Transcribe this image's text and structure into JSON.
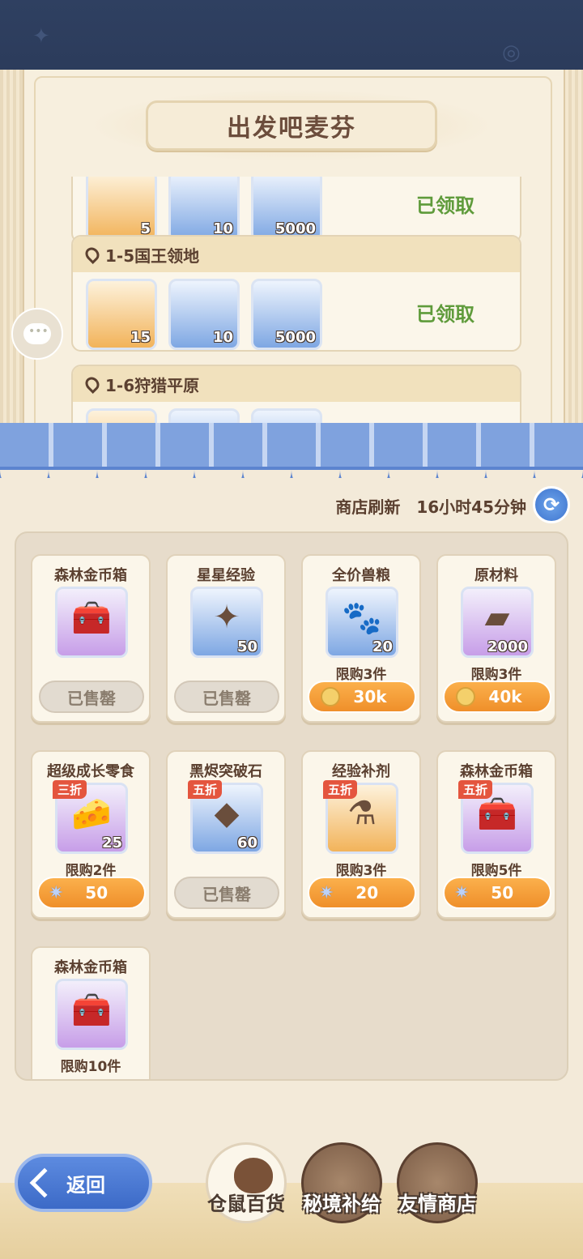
{
  "page_title": "出发吧麦芬",
  "stages": [
    {
      "name": "",
      "rewards": [
        {
          "icon": "blue-card",
          "count": "5",
          "bg": "orange"
        },
        {
          "icon": "dark-stone",
          "count": "10",
          "bg": "blue"
        },
        {
          "icon": "gold-coin",
          "count": "5000",
          "bg": "blue"
        }
      ],
      "status": "已领取"
    },
    {
      "name": "1-5国王领地",
      "rewards": [
        {
          "icon": "star-crystal",
          "count": "15",
          "bg": "orange"
        },
        {
          "icon": "star-card",
          "count": "10",
          "bg": "blue"
        },
        {
          "icon": "gold-coin",
          "count": "5000",
          "bg": "blue"
        }
      ],
      "status": "已领取"
    },
    {
      "name": "1-6狩猎平原",
      "rewards": [],
      "status": ""
    }
  ],
  "shop": {
    "refresh_label": "商店刷新",
    "refresh_time": "16小时45分钟",
    "items": [
      {
        "name": "森林金币箱",
        "icon": "treasure-chest",
        "bg": "purple",
        "count": "",
        "tag": "",
        "limit": "",
        "sold_out": "已售罄",
        "price": ""
      },
      {
        "name": "星星经验",
        "icon": "star-card",
        "bg": "blue",
        "count": "50",
        "tag": "",
        "limit": "",
        "sold_out": "已售罄",
        "price": ""
      },
      {
        "name": "全价兽粮",
        "icon": "food-bag",
        "bg": "blue",
        "count": "20",
        "tag": "",
        "limit": "限购3件",
        "sold_out": "",
        "price": "30k",
        "currency": "coin"
      },
      {
        "name": "原材料",
        "icon": "iron-ingot",
        "bg": "purple",
        "count": "2000",
        "tag": "",
        "limit": "限购3件",
        "sold_out": "",
        "price": "40k",
        "currency": "coin"
      },
      {
        "name": "超级成长零食",
        "icon": "cheese",
        "bg": "purple",
        "count": "25",
        "tag": "三折",
        "limit": "限购2件",
        "sold_out": "",
        "price": "50",
        "currency": "gem"
      },
      {
        "name": "黑烬突破石",
        "icon": "dark-stone",
        "bg": "blue",
        "count": "60",
        "tag": "五折",
        "limit": "",
        "sold_out": "已售罄",
        "price": ""
      },
      {
        "name": "经验补剂",
        "icon": "potion",
        "bg": "orange",
        "count": "",
        "tag": "五折",
        "limit": "限购3件",
        "sold_out": "",
        "price": "20",
        "currency": "gem"
      },
      {
        "name": "森林金币箱",
        "icon": "treasure-chest",
        "bg": "purple",
        "count": "",
        "tag": "五折",
        "limit": "限购5件",
        "sold_out": "",
        "price": "50",
        "currency": "gem"
      },
      {
        "name": "森林金币箱",
        "icon": "treasure-chest",
        "bg": "purple",
        "count": "",
        "tag": "",
        "limit": "限购10件",
        "sold_out": "",
        "price": ""
      }
    ]
  },
  "bottom": {
    "back_label": "返回",
    "tabs": [
      {
        "label": "仓鼠百货",
        "active": true
      },
      {
        "label": "秘境补给",
        "active": false
      },
      {
        "label": "友情商店",
        "active": false
      }
    ]
  }
}
